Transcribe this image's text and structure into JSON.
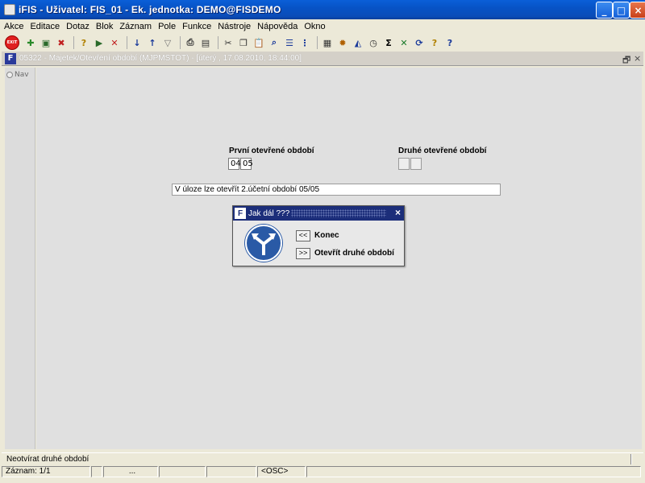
{
  "window": {
    "title": "iFIS - Uživatel: FIS_01 - Ek. jednotka: DEMO@FISDEMO",
    "minimize": "_",
    "maximize": "□",
    "close": "×"
  },
  "menu": [
    "Akce",
    "Editace",
    "Dotaz",
    "Blok",
    "Záznam",
    "Pole",
    "Funkce",
    "Nástroje",
    "Nápověda",
    "Okno"
  ],
  "toolbar": {
    "exit_label": "EXIT",
    "icons": [
      "new-record-icon",
      "save-icon",
      "delete-icon",
      "query-icon",
      "execute-query-icon",
      "cancel-query-icon",
      "sort-asc-icon",
      "sort-desc-icon",
      "filter-icon",
      "print-icon",
      "print-preview-icon",
      "cut-icon",
      "copy-icon",
      "paste-icon",
      "find-icon",
      "list-icon",
      "tree-icon",
      "calculator-icon",
      "settings-icon",
      "chart-icon",
      "clock-icon",
      "sum-icon",
      "excel-icon",
      "refresh-icon",
      "help-icon",
      "context-help-icon"
    ]
  },
  "inner_window": {
    "title": "05322 - Majetek/Otevření období (MJPMSTOT) - [úterý , 17.08.2010, 18:44:00]",
    "restore": "🗗",
    "close": "×",
    "icon_letter": "F"
  },
  "nav": {
    "label": "Nav"
  },
  "form": {
    "first_period_label": "První otevřené období",
    "first_period_a": "04",
    "first_period_b": "05",
    "second_period_label": "Druhé otevřené období",
    "second_period_a": "",
    "second_period_b": "",
    "message": "V úloze lze otevřít 2.účetní období 05/05"
  },
  "dialog": {
    "title": "Jak dál ???",
    "close": "×",
    "button1_symbol": "<<",
    "button1_label": "Konec",
    "button2_symbol": ">>",
    "button2_label": "Otevřít druhé období"
  },
  "status": {
    "hint": "Neotvírat druhé období",
    "record": "Záznam: 1/1",
    "ellipsis": "...",
    "mode": "<OSC>"
  },
  "colors": {
    "titlebar": "#0a5fd8",
    "dialog_title": "#1c2e7a",
    "sign": "#2a5aa6"
  }
}
